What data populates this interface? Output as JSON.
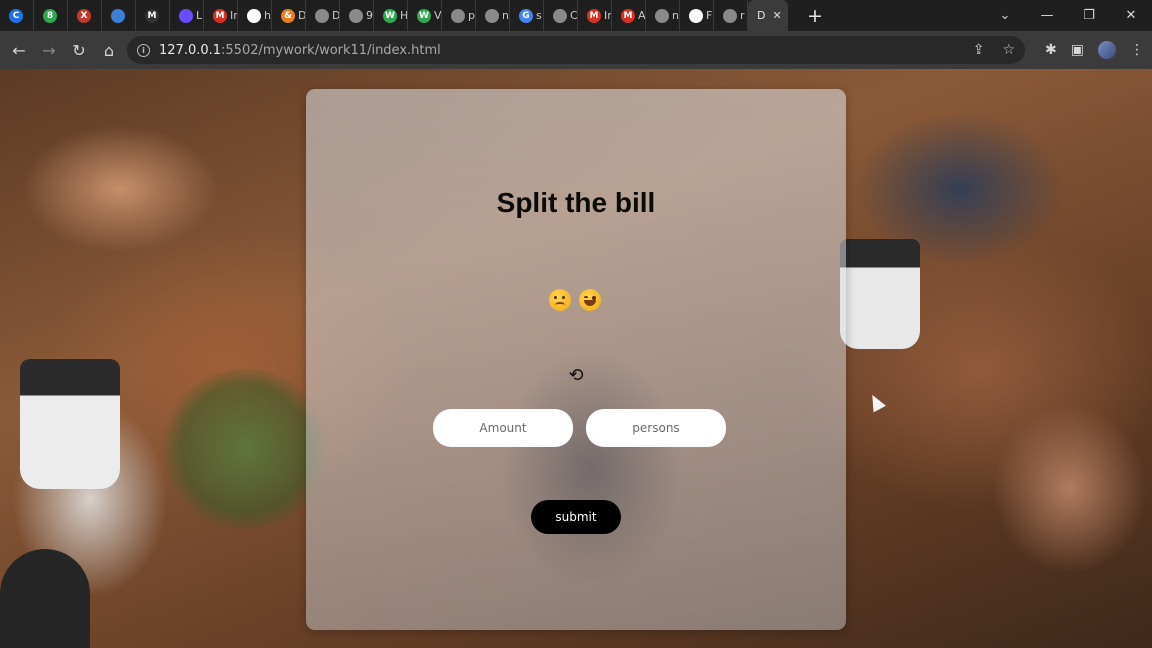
{
  "browser": {
    "tabs": [
      {
        "label": "",
        "icon": "C",
        "color": "#1a73e8"
      },
      {
        "label": "",
        "icon": "8",
        "color": "#2fa84f"
      },
      {
        "label": "",
        "icon": "X",
        "color": "#c0392b"
      },
      {
        "label": "",
        "icon": "",
        "color": "#3b7fd6"
      },
      {
        "label": "",
        "icon": "M",
        "color": "#333333"
      },
      {
        "label": "L",
        "icon": "",
        "color": "#6a4cff"
      },
      {
        "label": "Ir",
        "icon": "M",
        "color": "#d93025"
      },
      {
        "label": "h",
        "icon": "",
        "color": "#ffffff"
      },
      {
        "label": "D",
        "icon": "&",
        "color": "#e67e22"
      },
      {
        "label": "D",
        "icon": "",
        "color": "#8a8a8a"
      },
      {
        "label": "9",
        "icon": "",
        "color": "#8a8a8a"
      },
      {
        "label": "H",
        "icon": "W",
        "color": "#2fa84f"
      },
      {
        "label": "V",
        "icon": "W",
        "color": "#2fa84f"
      },
      {
        "label": "p",
        "icon": "",
        "color": "#8a8a8a"
      },
      {
        "label": "n",
        "icon": "",
        "color": "#8a8a8a"
      },
      {
        "label": "s",
        "icon": "G",
        "color": "#4285f4"
      },
      {
        "label": "C",
        "icon": "",
        "color": "#8a8a8a"
      },
      {
        "label": "Ir",
        "icon": "M",
        "color": "#d93025"
      },
      {
        "label": "A",
        "icon": "M",
        "color": "#d93025"
      },
      {
        "label": "n",
        "icon": "",
        "color": "#8a8a8a"
      },
      {
        "label": "F",
        "icon": "",
        "color": "#ffffff"
      },
      {
        "label": "r",
        "icon": "",
        "color": "#8a8a8a"
      }
    ],
    "active_tab": {
      "label": "D"
    },
    "url_host": "127.0.0.1",
    "url_rest": ":5502/mywork/work11/index.html"
  },
  "app": {
    "title": "Split the bill",
    "amount_placeholder": "Amount",
    "persons_placeholder": "persons",
    "submit_label": "submit"
  }
}
